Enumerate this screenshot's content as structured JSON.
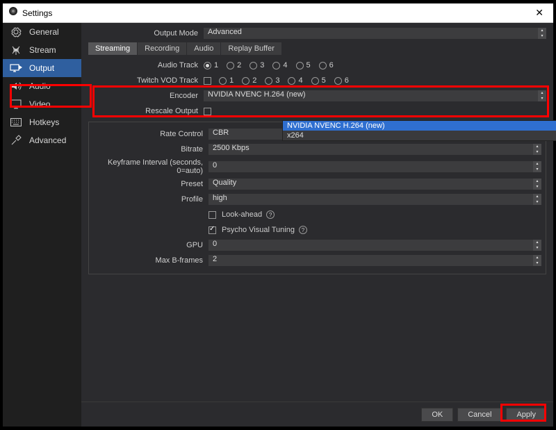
{
  "window": {
    "title": "Settings"
  },
  "sidebar": {
    "items": [
      {
        "label": "General",
        "icon": "gear-icon"
      },
      {
        "label": "Stream",
        "icon": "antenna-icon"
      },
      {
        "label": "Output",
        "icon": "output-icon",
        "active": true
      },
      {
        "label": "Audio",
        "icon": "speaker-icon"
      },
      {
        "label": "Video",
        "icon": "monitor-icon"
      },
      {
        "label": "Hotkeys",
        "icon": "keyboard-icon"
      },
      {
        "label": "Advanced",
        "icon": "tools-icon"
      }
    ]
  },
  "output_mode": {
    "label": "Output Mode",
    "value": "Advanced"
  },
  "tabs": [
    "Streaming",
    "Recording",
    "Audio",
    "Replay Buffer"
  ],
  "audio_track": {
    "label": "Audio Track",
    "options": [
      "1",
      "2",
      "3",
      "4",
      "5",
      "6"
    ],
    "selected": 0
  },
  "twitch_vod": {
    "label": "Twitch VOD Track",
    "options": [
      "1",
      "2",
      "3",
      "4",
      "5",
      "6"
    ]
  },
  "encoder": {
    "label": "Encoder",
    "value": "NVIDIA NVENC H.264 (new)",
    "options": [
      "NVIDIA NVENC H.264 (new)",
      "x264"
    ],
    "selected_option": 0
  },
  "rescale": {
    "label": "Rescale Output"
  },
  "rate_control": {
    "label": "Rate Control",
    "value": "CBR"
  },
  "bitrate": {
    "label": "Bitrate",
    "value": "2500 Kbps"
  },
  "keyframe": {
    "label": "Keyframe Interval (seconds, 0=auto)",
    "value": "0"
  },
  "preset": {
    "label": "Preset",
    "value": "Quality"
  },
  "profile": {
    "label": "Profile",
    "value": "high"
  },
  "lookahead": {
    "label": "Look-ahead",
    "checked": false
  },
  "psycho": {
    "label": "Psycho Visual Tuning",
    "checked": true
  },
  "gpu": {
    "label": "GPU",
    "value": "0"
  },
  "max_bframes": {
    "label": "Max B-frames",
    "value": "2"
  },
  "footer": {
    "ok": "OK",
    "cancel": "Cancel",
    "apply": "Apply"
  }
}
